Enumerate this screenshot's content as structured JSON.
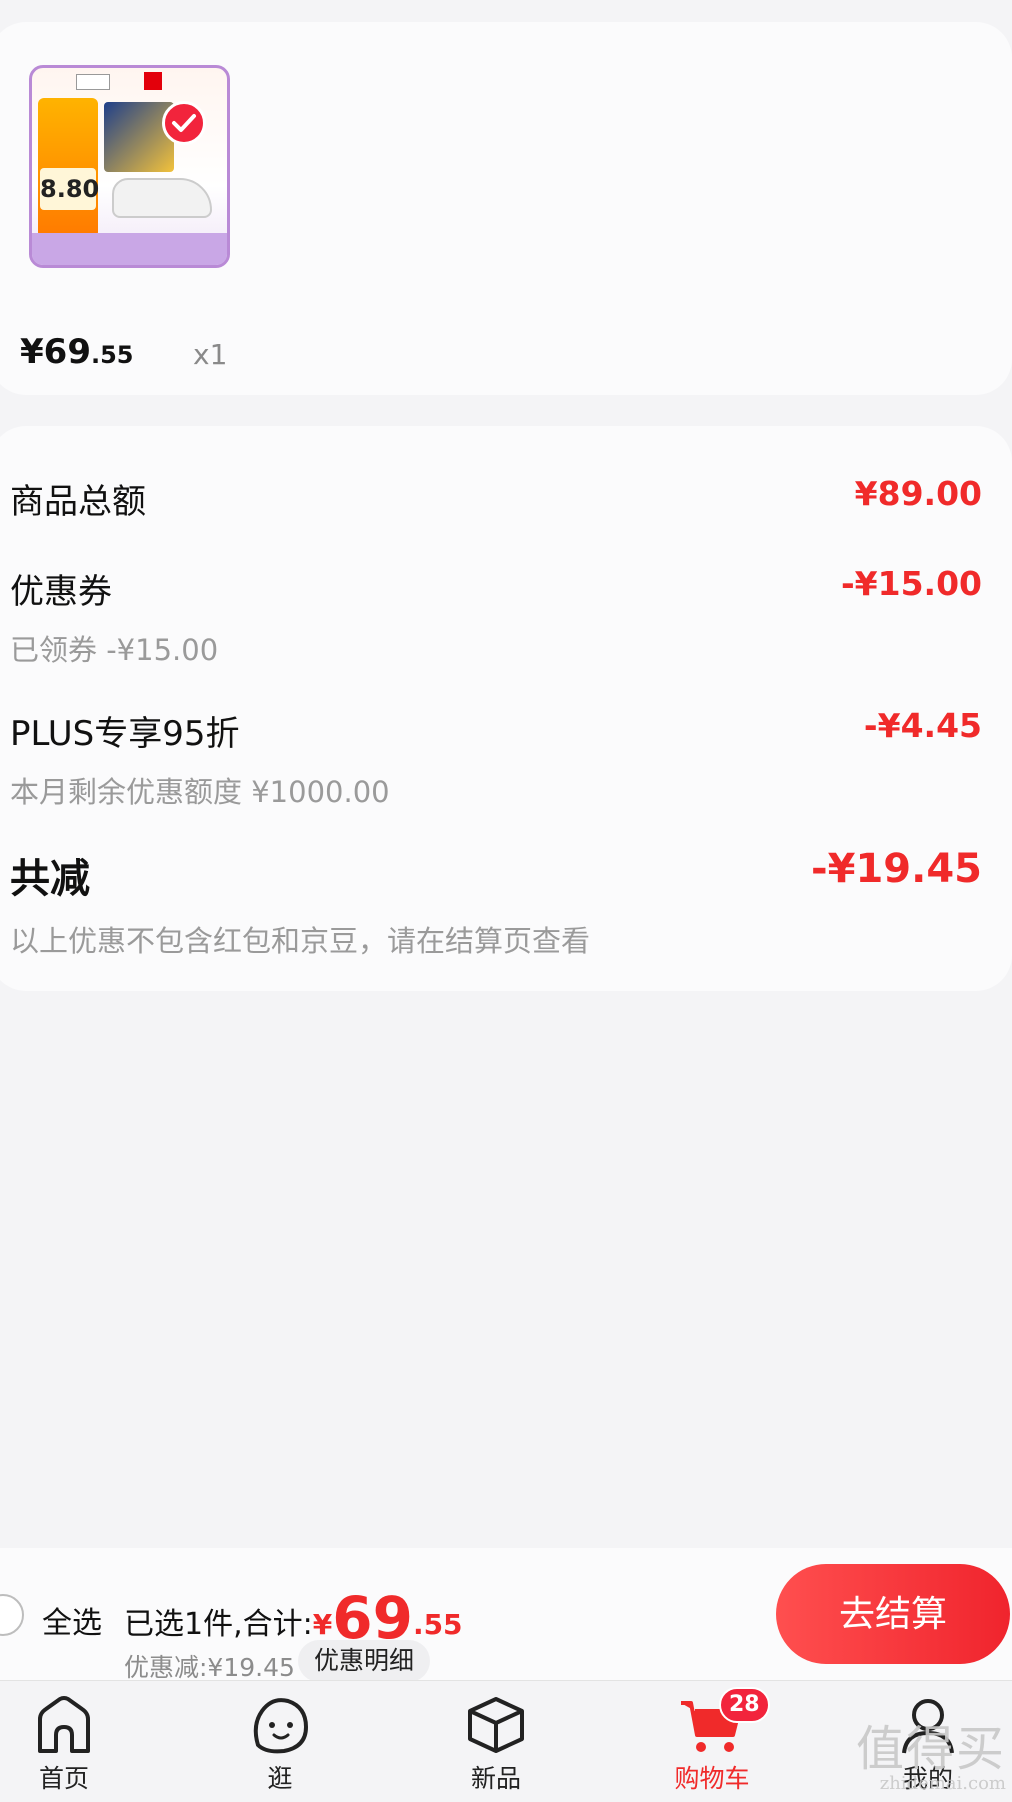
{
  "product": {
    "price_integer": "¥69",
    "price_decimal": ".55",
    "quantity": "x1",
    "thumb_badge_price": "8.80",
    "selected": true
  },
  "summary": {
    "goods_total_label": "商品总额",
    "goods_total_value": "¥89.00",
    "coupon_label": "优惠券",
    "coupon_value": "-¥15.00",
    "coupon_sub": "已领券 -¥15.00",
    "plus_label": "PLUS专享95折",
    "plus_value": "-¥4.45",
    "plus_sub": "本月剩余优惠额度 ¥1000.00",
    "total_cut_label": "共减",
    "total_cut_value": "-¥19.45",
    "total_cut_note": "以上优惠不包含红包和京豆，请在结算页查看"
  },
  "checkout": {
    "select_all_label": "全选",
    "selected_text": "已选1件,合计:",
    "currency": "¥",
    "total_integer": "69",
    "total_decimal": ".55",
    "discount_text": "优惠减:¥19.45",
    "detail_button": "优惠明细",
    "checkout_button": "去结算"
  },
  "tabs": [
    {
      "label": "首页",
      "icon": "home-icon"
    },
    {
      "label": "逛",
      "icon": "face-icon"
    },
    {
      "label": "新品",
      "icon": "cube-icon"
    },
    {
      "label": "购物车",
      "icon": "cart-icon",
      "badge": "28",
      "active": true
    },
    {
      "label": "我的",
      "icon": "user-icon"
    }
  ],
  "watermark": {
    "logo": "值得买",
    "url": "zhidemai.com"
  },
  "colors": {
    "accent_red": "#f02a2a",
    "background": "#f4f4f6",
    "card": "#fbfbfc"
  }
}
